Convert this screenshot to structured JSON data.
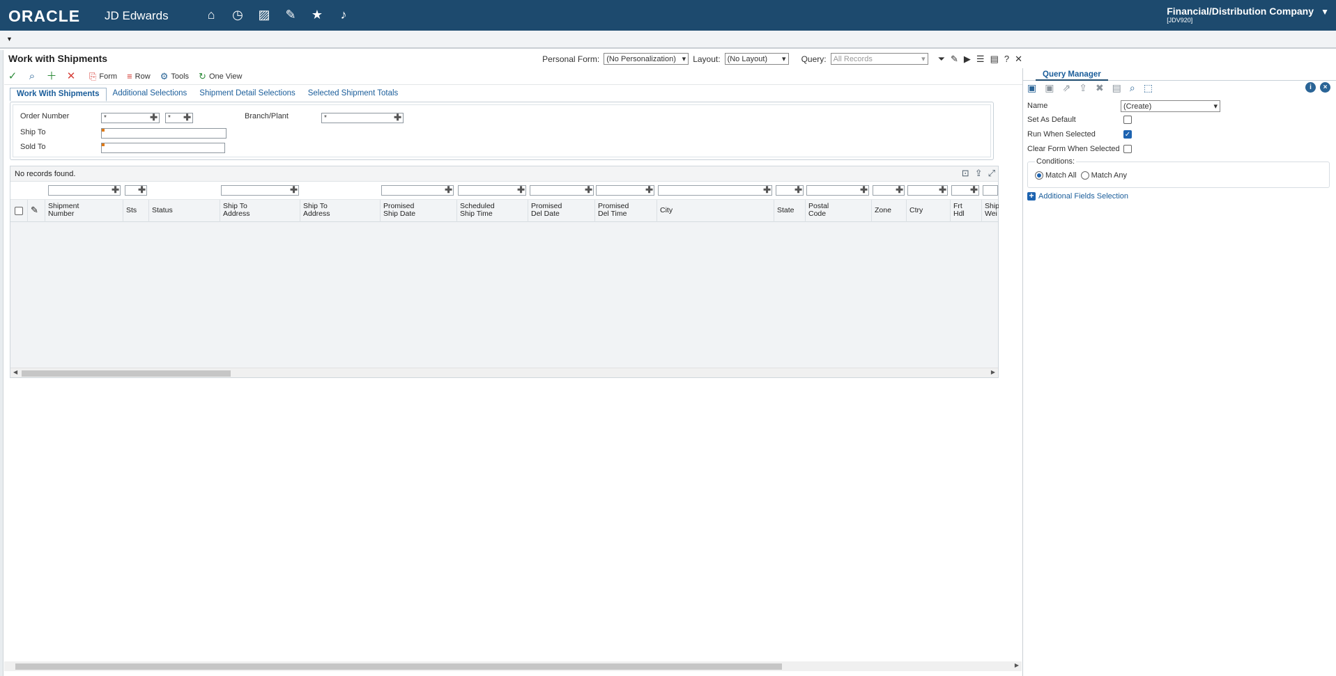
{
  "app": {
    "logo": "ORACLE",
    "product": "JD Edwards",
    "company_name": "Financial/Distribution Company",
    "environment": "[JDV920]",
    "top_icons": [
      "home-icon",
      "recent-icon",
      "chart-icon",
      "edit-icon",
      "star-icon",
      "bell-icon"
    ]
  },
  "form": {
    "title": "Work with Shipments",
    "personal_form_label": "Personal Form:",
    "personal_form_value": "(No Personalization)",
    "layout_label": "Layout:",
    "layout_value": "(No Layout)",
    "query_label": "Query:",
    "query_value": "All Records"
  },
  "toolbar": {
    "form_label": "Form",
    "row_label": "Row",
    "tools_label": "Tools",
    "oneview_label": "One View"
  },
  "tabs": [
    {
      "label": "Work With Shipments",
      "active": true
    },
    {
      "label": "Additional Selections",
      "active": false
    },
    {
      "label": "Shipment Detail Selections",
      "active": false
    },
    {
      "label": "Selected Shipment Totals",
      "active": false
    }
  ],
  "filters": {
    "order_number_label": "Order Number",
    "order_number_value": "*",
    "order_type_value": "*",
    "branch_plant_label": "Branch/Plant",
    "branch_plant_value": "*",
    "ship_to_label": "Ship To",
    "ship_to_value": "",
    "sold_to_label": "Sold To",
    "sold_to_value": ""
  },
  "grid": {
    "status_text": "No records found.",
    "columns": [
      {
        "l1": "Shipment",
        "l2": "Number"
      },
      {
        "l1": "Sts",
        "l2": ""
      },
      {
        "l1": "Status",
        "l2": ""
      },
      {
        "l1": "Ship To",
        "l2": "Address"
      },
      {
        "l1": "Ship To",
        "l2": "Address"
      },
      {
        "l1": "Promised",
        "l2": "Ship Date"
      },
      {
        "l1": "Scheduled",
        "l2": "Ship Time"
      },
      {
        "l1": "Promised",
        "l2": "Del Date"
      },
      {
        "l1": "Promised",
        "l2": "Del Time"
      },
      {
        "l1": "City",
        "l2": ""
      },
      {
        "l1": "State",
        "l2": ""
      },
      {
        "l1": "Postal",
        "l2": "Code"
      },
      {
        "l1": "Zone",
        "l2": ""
      },
      {
        "l1": "Ctry",
        "l2": ""
      },
      {
        "l1": "Frt",
        "l2": "Hdl"
      },
      {
        "l1": "Ship",
        "l2": "Wei"
      }
    ]
  },
  "query_manager": {
    "tab_label": "Query Manager",
    "name_label": "Name",
    "name_value": "(Create)",
    "set_default_label": "Set As Default",
    "set_default_checked": false,
    "run_when_selected_label": "Run When Selected",
    "run_when_selected_checked": true,
    "clear_form_label": "Clear Form When Selected",
    "clear_form_checked": false,
    "conditions_label": "Conditions:",
    "match_all_label": "Match All",
    "match_any_label": "Match Any",
    "match_selected": "Match All",
    "additional_fields_label": "Additional Fields Selection"
  },
  "colors": {
    "header_bg": "#1d4a6e",
    "link": "#1a5d9a",
    "required_marker": "#e07a17"
  }
}
